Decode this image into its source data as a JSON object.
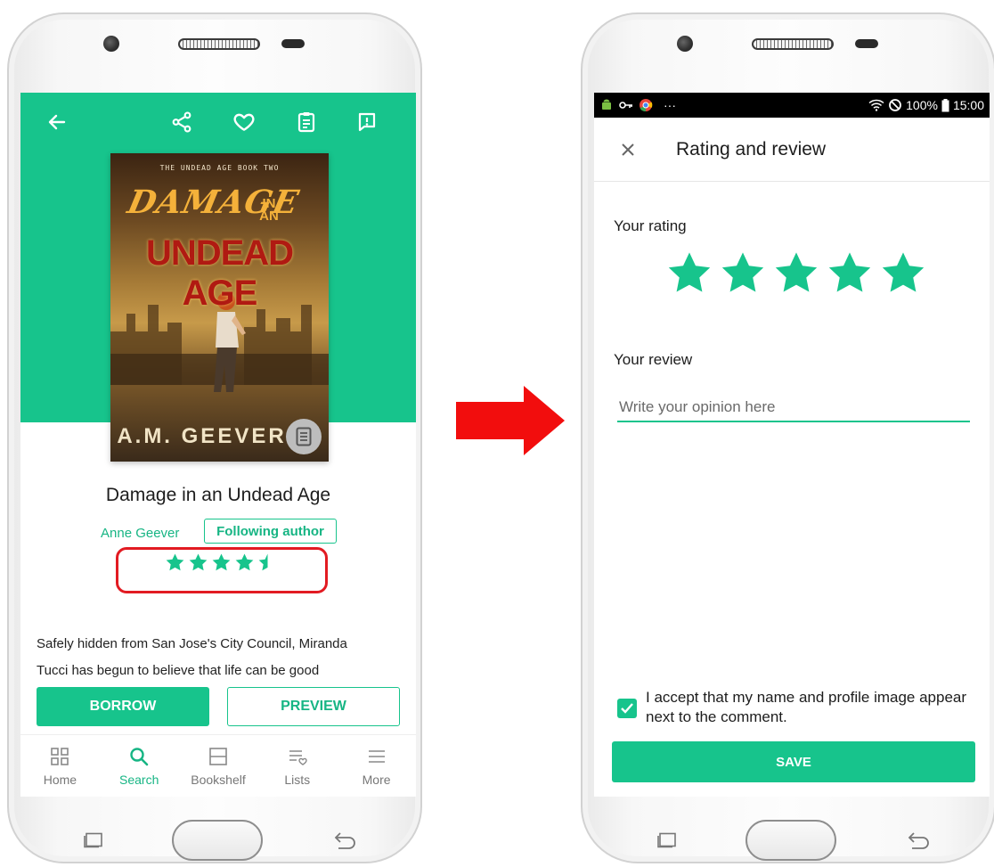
{
  "left_screen": {
    "toolbar": {
      "back": "arrow-left-icon",
      "share": "share-icon",
      "favorite": "heart-icon",
      "clipboard": "clipboard-icon",
      "report": "report-icon"
    },
    "cover": {
      "series": "THE UNDEAD AGE BOOK TWO",
      "title_line1": "DAMAGE",
      "title_line2": "IN AN",
      "title_line3": "UNDEAD AGE",
      "author": "A.M. GEEVER"
    },
    "book": {
      "title": "Damage in an Undead Age",
      "author": "Anne Geever",
      "follow_label": "Following author",
      "rating": 4.5,
      "rating_max": 5,
      "synopsis_line1": "Safely hidden from San Jose's City Council, Miranda",
      "synopsis_line2": "Tucci has begun to believe that life can be good"
    },
    "actions": {
      "borrow": "BORROW",
      "preview": "PREVIEW"
    },
    "tabs": [
      {
        "label": "Home",
        "icon": "grid-icon"
      },
      {
        "label": "Search",
        "icon": "search-icon"
      },
      {
        "label": "Bookshelf",
        "icon": "bookshelf-icon"
      },
      {
        "label": "Lists",
        "icon": "list-heart-icon"
      },
      {
        "label": "More",
        "icon": "menu-icon"
      }
    ],
    "active_tab": "Search",
    "highlight_color": "#e21b22"
  },
  "right_screen": {
    "status": {
      "dots": "···",
      "battery": "100%",
      "time": "15:00"
    },
    "header": {
      "title": "Rating and review"
    },
    "rating_label": "Your rating",
    "rating": 5,
    "review_label": "Your review",
    "review_placeholder": "Write your opinion here",
    "consent_text": "I accept that my name and profile image appear next to the comment.",
    "consent_checked": true,
    "save_label": "SAVE"
  },
  "colors": {
    "accent": "#17c48c",
    "arrow": "#f20d0d"
  }
}
